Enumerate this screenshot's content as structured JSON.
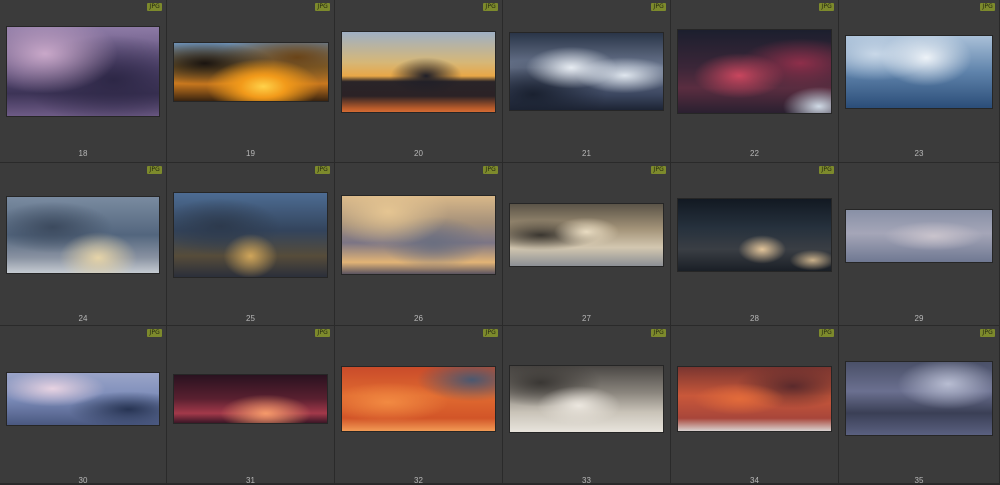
{
  "grid": {
    "badge_label": "JPG",
    "items": [
      {
        "number": "18"
      },
      {
        "number": "19"
      },
      {
        "number": "20"
      },
      {
        "number": "21"
      },
      {
        "number": "22"
      },
      {
        "number": "23"
      },
      {
        "number": "24"
      },
      {
        "number": "25"
      },
      {
        "number": "26"
      },
      {
        "number": "27"
      },
      {
        "number": "28"
      },
      {
        "number": "29"
      },
      {
        "number": "30"
      },
      {
        "number": "31"
      },
      {
        "number": "32"
      },
      {
        "number": "33"
      },
      {
        "number": "34"
      },
      {
        "number": "35"
      }
    ]
  },
  "colors": {
    "background": "#2a2a2a",
    "cell": "#3b3b3b",
    "badge": "#7d8a2c",
    "number_text": "#b8b8b8"
  }
}
